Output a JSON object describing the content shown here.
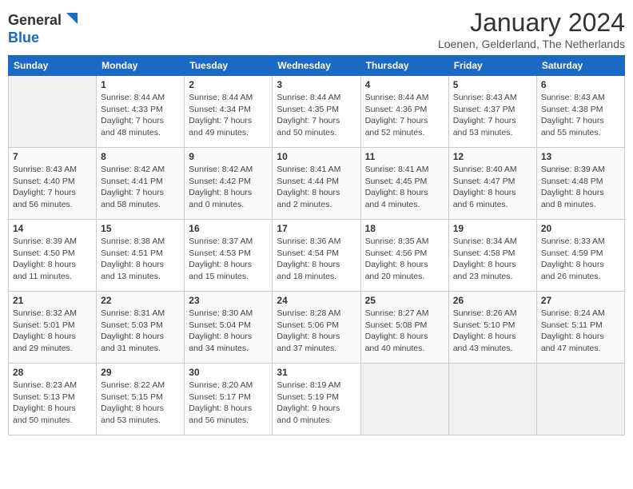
{
  "header": {
    "logo_general": "General",
    "logo_blue": "Blue",
    "month_year": "January 2024",
    "location": "Loenen, Gelderland, The Netherlands"
  },
  "days_of_week": [
    "Sunday",
    "Monday",
    "Tuesday",
    "Wednesday",
    "Thursday",
    "Friday",
    "Saturday"
  ],
  "weeks": [
    [
      {
        "day": "",
        "info": ""
      },
      {
        "day": "1",
        "info": "Sunrise: 8:44 AM\nSunset: 4:33 PM\nDaylight: 7 hours\nand 48 minutes."
      },
      {
        "day": "2",
        "info": "Sunrise: 8:44 AM\nSunset: 4:34 PM\nDaylight: 7 hours\nand 49 minutes."
      },
      {
        "day": "3",
        "info": "Sunrise: 8:44 AM\nSunset: 4:35 PM\nDaylight: 7 hours\nand 50 minutes."
      },
      {
        "day": "4",
        "info": "Sunrise: 8:44 AM\nSunset: 4:36 PM\nDaylight: 7 hours\nand 52 minutes."
      },
      {
        "day": "5",
        "info": "Sunrise: 8:43 AM\nSunset: 4:37 PM\nDaylight: 7 hours\nand 53 minutes."
      },
      {
        "day": "6",
        "info": "Sunrise: 8:43 AM\nSunset: 4:38 PM\nDaylight: 7 hours\nand 55 minutes."
      }
    ],
    [
      {
        "day": "7",
        "info": "Sunrise: 8:43 AM\nSunset: 4:40 PM\nDaylight: 7 hours\nand 56 minutes."
      },
      {
        "day": "8",
        "info": "Sunrise: 8:42 AM\nSunset: 4:41 PM\nDaylight: 7 hours\nand 58 minutes."
      },
      {
        "day": "9",
        "info": "Sunrise: 8:42 AM\nSunset: 4:42 PM\nDaylight: 8 hours\nand 0 minutes."
      },
      {
        "day": "10",
        "info": "Sunrise: 8:41 AM\nSunset: 4:44 PM\nDaylight: 8 hours\nand 2 minutes."
      },
      {
        "day": "11",
        "info": "Sunrise: 8:41 AM\nSunset: 4:45 PM\nDaylight: 8 hours\nand 4 minutes."
      },
      {
        "day": "12",
        "info": "Sunrise: 8:40 AM\nSunset: 4:47 PM\nDaylight: 8 hours\nand 6 minutes."
      },
      {
        "day": "13",
        "info": "Sunrise: 8:39 AM\nSunset: 4:48 PM\nDaylight: 8 hours\nand 8 minutes."
      }
    ],
    [
      {
        "day": "14",
        "info": "Sunrise: 8:39 AM\nSunset: 4:50 PM\nDaylight: 8 hours\nand 11 minutes."
      },
      {
        "day": "15",
        "info": "Sunrise: 8:38 AM\nSunset: 4:51 PM\nDaylight: 8 hours\nand 13 minutes."
      },
      {
        "day": "16",
        "info": "Sunrise: 8:37 AM\nSunset: 4:53 PM\nDaylight: 8 hours\nand 15 minutes."
      },
      {
        "day": "17",
        "info": "Sunrise: 8:36 AM\nSunset: 4:54 PM\nDaylight: 8 hours\nand 18 minutes."
      },
      {
        "day": "18",
        "info": "Sunrise: 8:35 AM\nSunset: 4:56 PM\nDaylight: 8 hours\nand 20 minutes."
      },
      {
        "day": "19",
        "info": "Sunrise: 8:34 AM\nSunset: 4:58 PM\nDaylight: 8 hours\nand 23 minutes."
      },
      {
        "day": "20",
        "info": "Sunrise: 8:33 AM\nSunset: 4:59 PM\nDaylight: 8 hours\nand 26 minutes."
      }
    ],
    [
      {
        "day": "21",
        "info": "Sunrise: 8:32 AM\nSunset: 5:01 PM\nDaylight: 8 hours\nand 29 minutes."
      },
      {
        "day": "22",
        "info": "Sunrise: 8:31 AM\nSunset: 5:03 PM\nDaylight: 8 hours\nand 31 minutes."
      },
      {
        "day": "23",
        "info": "Sunrise: 8:30 AM\nSunset: 5:04 PM\nDaylight: 8 hours\nand 34 minutes."
      },
      {
        "day": "24",
        "info": "Sunrise: 8:28 AM\nSunset: 5:06 PM\nDaylight: 8 hours\nand 37 minutes."
      },
      {
        "day": "25",
        "info": "Sunrise: 8:27 AM\nSunset: 5:08 PM\nDaylight: 8 hours\nand 40 minutes."
      },
      {
        "day": "26",
        "info": "Sunrise: 8:26 AM\nSunset: 5:10 PM\nDaylight: 8 hours\nand 43 minutes."
      },
      {
        "day": "27",
        "info": "Sunrise: 8:24 AM\nSunset: 5:11 PM\nDaylight: 8 hours\nand 47 minutes."
      }
    ],
    [
      {
        "day": "28",
        "info": "Sunrise: 8:23 AM\nSunset: 5:13 PM\nDaylight: 8 hours\nand 50 minutes."
      },
      {
        "day": "29",
        "info": "Sunrise: 8:22 AM\nSunset: 5:15 PM\nDaylight: 8 hours\nand 53 minutes."
      },
      {
        "day": "30",
        "info": "Sunrise: 8:20 AM\nSunset: 5:17 PM\nDaylight: 8 hours\nand 56 minutes."
      },
      {
        "day": "31",
        "info": "Sunrise: 8:19 AM\nSunset: 5:19 PM\nDaylight: 9 hours\nand 0 minutes."
      },
      {
        "day": "",
        "info": ""
      },
      {
        "day": "",
        "info": ""
      },
      {
        "day": "",
        "info": ""
      }
    ]
  ]
}
